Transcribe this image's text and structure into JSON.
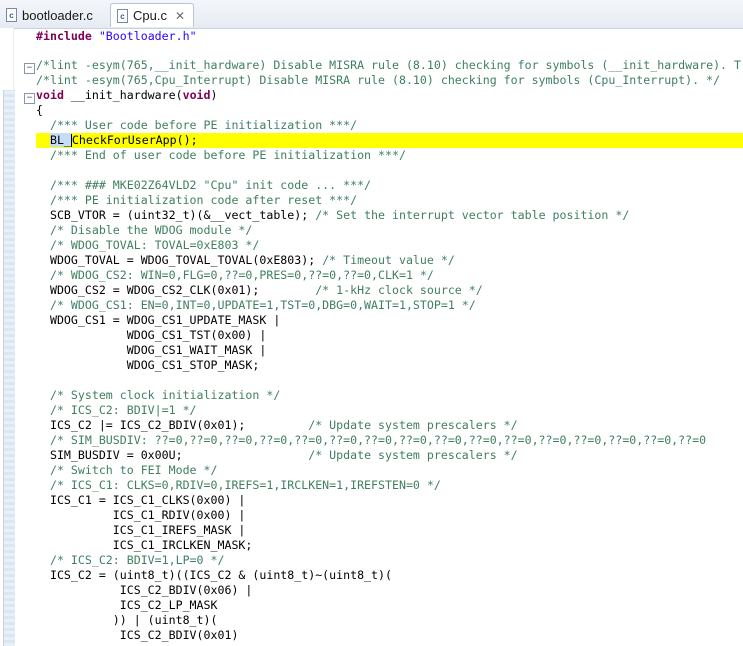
{
  "tabs": [
    {
      "label": "bootloader.c",
      "active": false
    },
    {
      "label": "Cpu.c",
      "active": true
    }
  ],
  "colors": {
    "keyword": "#7f0055",
    "string": "#2a00ff",
    "comment": "#3f7f5f",
    "highlight": "#ffff00"
  },
  "code": {
    "l1_kw": "#include",
    "l1_str": "\"Bootloader.h\"",
    "l3": "/*lint -esym(765,__init_hardware) Disable MISRA rule (8.10) checking for symbols (__init_hardware). T",
    "l4": "/*lint -esym(765,Cpu_Interrupt) Disable MISRA rule (8.10) checking for symbols (Cpu_Interrupt). */",
    "l5_kw": "void",
    "l5_rest": " __init_hardware(",
    "l5_kw2": "void",
    "l5_end": ")",
    "l6": "{",
    "l7": "  /*** User code before PE initialization ***/",
    "l8_sel": "BL_",
    "l8_rest": "CheckForUserApp();",
    "l9": "  /*** End of user code before PE initialization ***/",
    "l11": "  /*** ### MKE02Z64VLD2 \"Cpu\" init code ... ***/",
    "l12": "  /*** PE initialization code after reset ***/",
    "l13a": "  SCB_VTOR = (uint32_t)(&__vect_table); ",
    "l13b": "/* Set the interrupt vector table position */",
    "l14": "  /* Disable the WDOG module */",
    "l15": "  /* WDOG_TOVAL: TOVAL=0xE803 */",
    "l16a": "  WDOG_TOVAL = WDOG_TOVAL_TOVAL(0xE803); ",
    "l16b": "/* Timeout value */",
    "l17": "  /* WDOG_CS2: WIN=0,FLG=0,??=0,PRES=0,??=0,??=0,CLK=1 */",
    "l18a": "  WDOG_CS2 = WDOG_CS2_CLK(0x01);        ",
    "l18b": "/* 1-kHz clock source */",
    "l19": "  /* WDOG_CS1: EN=0,INT=0,UPDATE=1,TST=0,DBG=0,WAIT=1,STOP=1 */",
    "l20": "  WDOG_CS1 = WDOG_CS1_UPDATE_MASK |",
    "l21": "             WDOG_CS1_TST(0x00) |",
    "l22": "             WDOG_CS1_WAIT_MASK |",
    "l23": "             WDOG_CS1_STOP_MASK;",
    "l25": "  /* System clock initialization */",
    "l26": "  /* ICS_C2: BDIV|=1 */",
    "l27a": "  ICS_C2 |= ICS_C2_BDIV(0x01);         ",
    "l27b": "/* Update system prescalers */",
    "l28": "  /* SIM_BUSDIV: ??=0,??=0,??=0,??=0,??=0,??=0,??=0,??=0,??=0,??=0,??=0,??=0,??=0,??=0,??=0,??=0",
    "l29a": "  SIM_BUSDIV = 0x00U;                  ",
    "l29b": "/* Update system prescalers */",
    "l30": "  /* Switch to FEI Mode */",
    "l31": "  /* ICS_C1: CLKS=0,RDIV=0,IREFS=1,IRCLKEN=1,IREFSTEN=0 */",
    "l32": "  ICS_C1 = ICS_C1_CLKS(0x00) |",
    "l33": "           ICS_C1_RDIV(0x00) |",
    "l34": "           ICS_C1_IREFS_MASK |",
    "l35": "           ICS_C1_IRCLKEN_MASK;",
    "l36": "  /* ICS_C2: BDIV=1,LP=0 */",
    "l37": "  ICS_C2 = (uint8_t)((ICS_C2 & (uint8_t)~(uint8_t)(",
    "l38": "            ICS_C2_BDIV(0x06) |",
    "l39": "            ICS_C2_LP_MASK",
    "l40": "           )) | (uint8_t)(",
    "l41": "            ICS_C2_BDIV(0x01)"
  }
}
